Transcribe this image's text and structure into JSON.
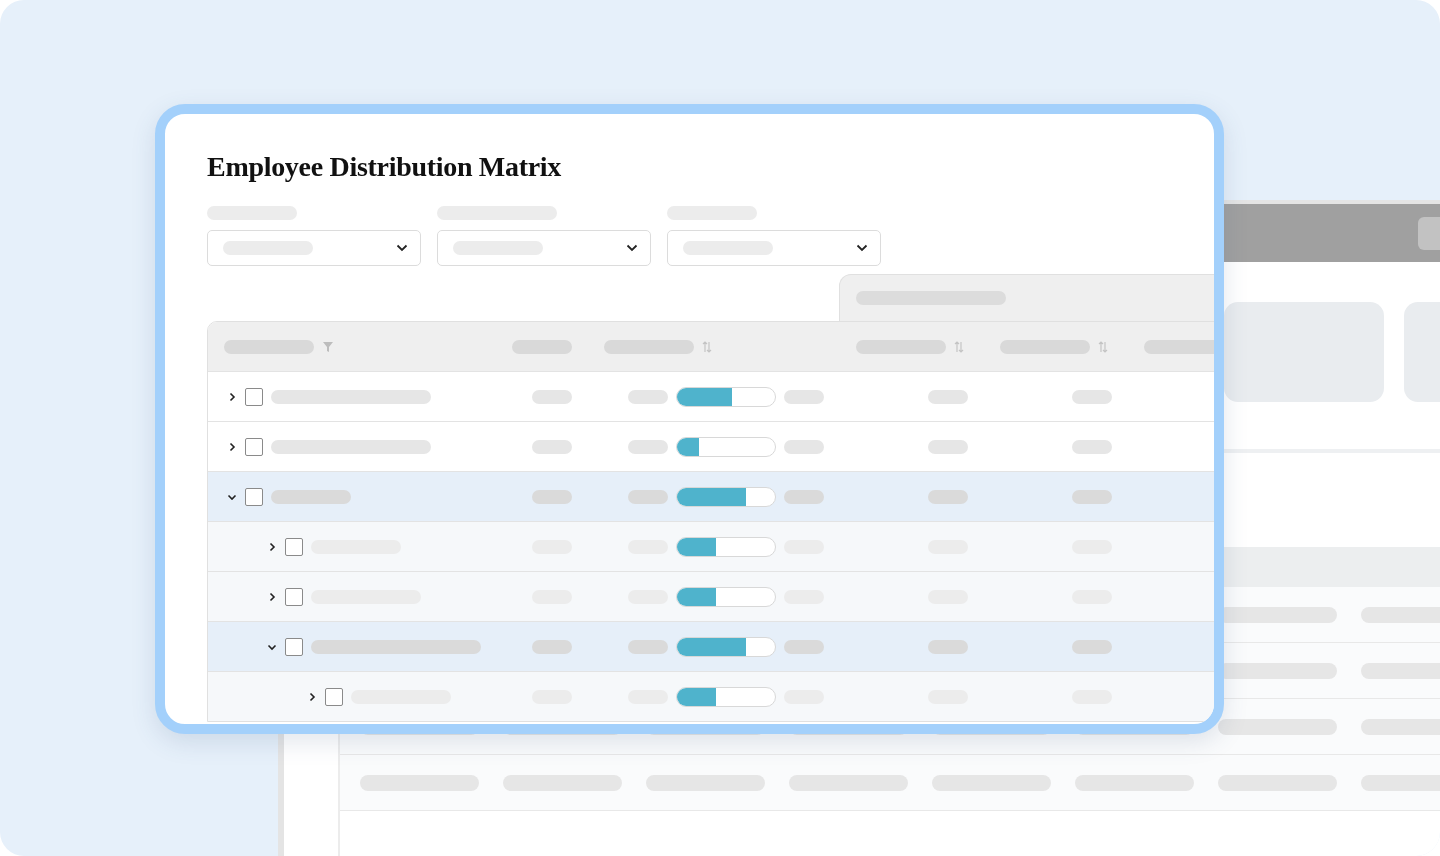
{
  "title": "Employee Distribution Matrix",
  "rows": [
    {
      "expanded": false,
      "checked": false,
      "level": 0.56
    },
    {
      "expanded": false,
      "checked": false,
      "level": 0.22
    },
    {
      "expanded": true,
      "checked": false,
      "level": 0.7,
      "children": [
        {
          "expanded": false,
          "checked": false,
          "level": 0.4
        },
        {
          "expanded": false,
          "checked": false,
          "level": 0.4
        },
        {
          "expanded": true,
          "checked": false,
          "level": 0.7,
          "children": [
            {
              "expanded": false,
              "checked": false,
              "level": 0.4
            }
          ]
        }
      ]
    }
  ]
}
